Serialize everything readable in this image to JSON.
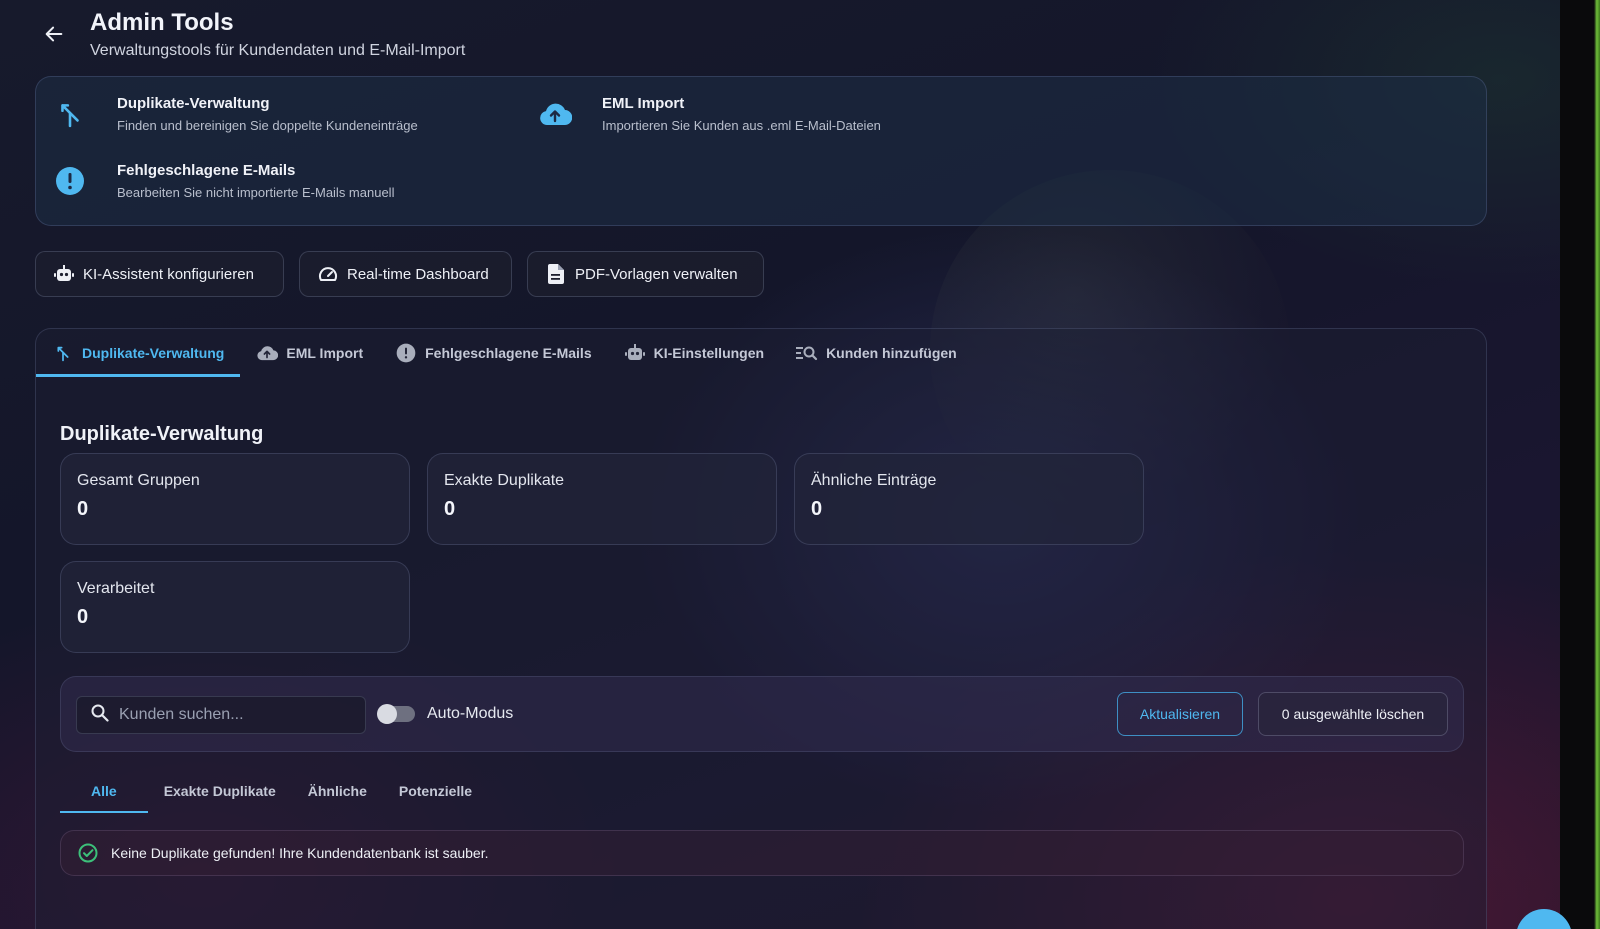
{
  "colors": {
    "accent": "#4fb8f0",
    "success": "#3cc07a",
    "background": "#14162a"
  },
  "header": {
    "title": "Admin Tools",
    "subtitle": "Verwaltungstools für Kundendaten und E-Mail-Import",
    "back_icon": "arrow-left-icon"
  },
  "overview": {
    "items": [
      {
        "icon": "merge-icon",
        "title": "Duplikate-Verwaltung",
        "description": "Finden und bereinigen Sie doppelte Kundeneinträge"
      },
      {
        "icon": "cloud-upload-icon",
        "title": "EML Import",
        "description": "Importieren Sie Kunden aus .eml E-Mail-Dateien"
      },
      {
        "icon": "alert-circle-icon",
        "title": "Fehlgeschlagene E-Mails",
        "description": "Bearbeiten Sie nicht importierte E-Mails manuell"
      }
    ]
  },
  "quick_actions": [
    {
      "icon": "robot-icon",
      "label": "KI-Assistent konfigurieren"
    },
    {
      "icon": "speedometer-icon",
      "label": "Real-time Dashboard"
    },
    {
      "icon": "document-icon",
      "label": "PDF-Vorlagen verwalten"
    }
  ],
  "tabs": [
    {
      "icon": "merge-icon",
      "label": "Duplikate-Verwaltung",
      "active": true
    },
    {
      "icon": "cloud-upload-icon",
      "label": "EML Import"
    },
    {
      "icon": "alert-circle-icon",
      "label": "Fehlgeschlagene E-Mails"
    },
    {
      "icon": "robot-icon",
      "label": "KI-Einstellungen"
    },
    {
      "icon": "list-search-icon",
      "label": "Kunden hinzufügen"
    }
  ],
  "section": {
    "title": "Duplikate-Verwaltung",
    "stats": [
      {
        "label": "Gesamt Gruppen",
        "value": "0"
      },
      {
        "label": "Exakte Duplikate",
        "value": "0"
      },
      {
        "label": "Ähnliche Einträge",
        "value": "0"
      },
      {
        "label": "Verarbeitet",
        "value": "0"
      }
    ]
  },
  "toolbar": {
    "search_placeholder": "Kunden suchen...",
    "search_value": "",
    "auto_mode_label": "Auto-Modus",
    "auto_mode_on": false,
    "refresh_label": "Aktualisieren",
    "delete_label": "0 ausgewählte löschen"
  },
  "filter_tabs": [
    {
      "label": "Alle",
      "active": true
    },
    {
      "label": "Exakte Duplikate"
    },
    {
      "label": "Ähnliche"
    },
    {
      "label": "Potenzielle"
    }
  ],
  "alert": {
    "icon": "check-circle-icon",
    "text": "Keine Duplikate gefunden! Ihre Kundendatenbank ist sauber."
  }
}
